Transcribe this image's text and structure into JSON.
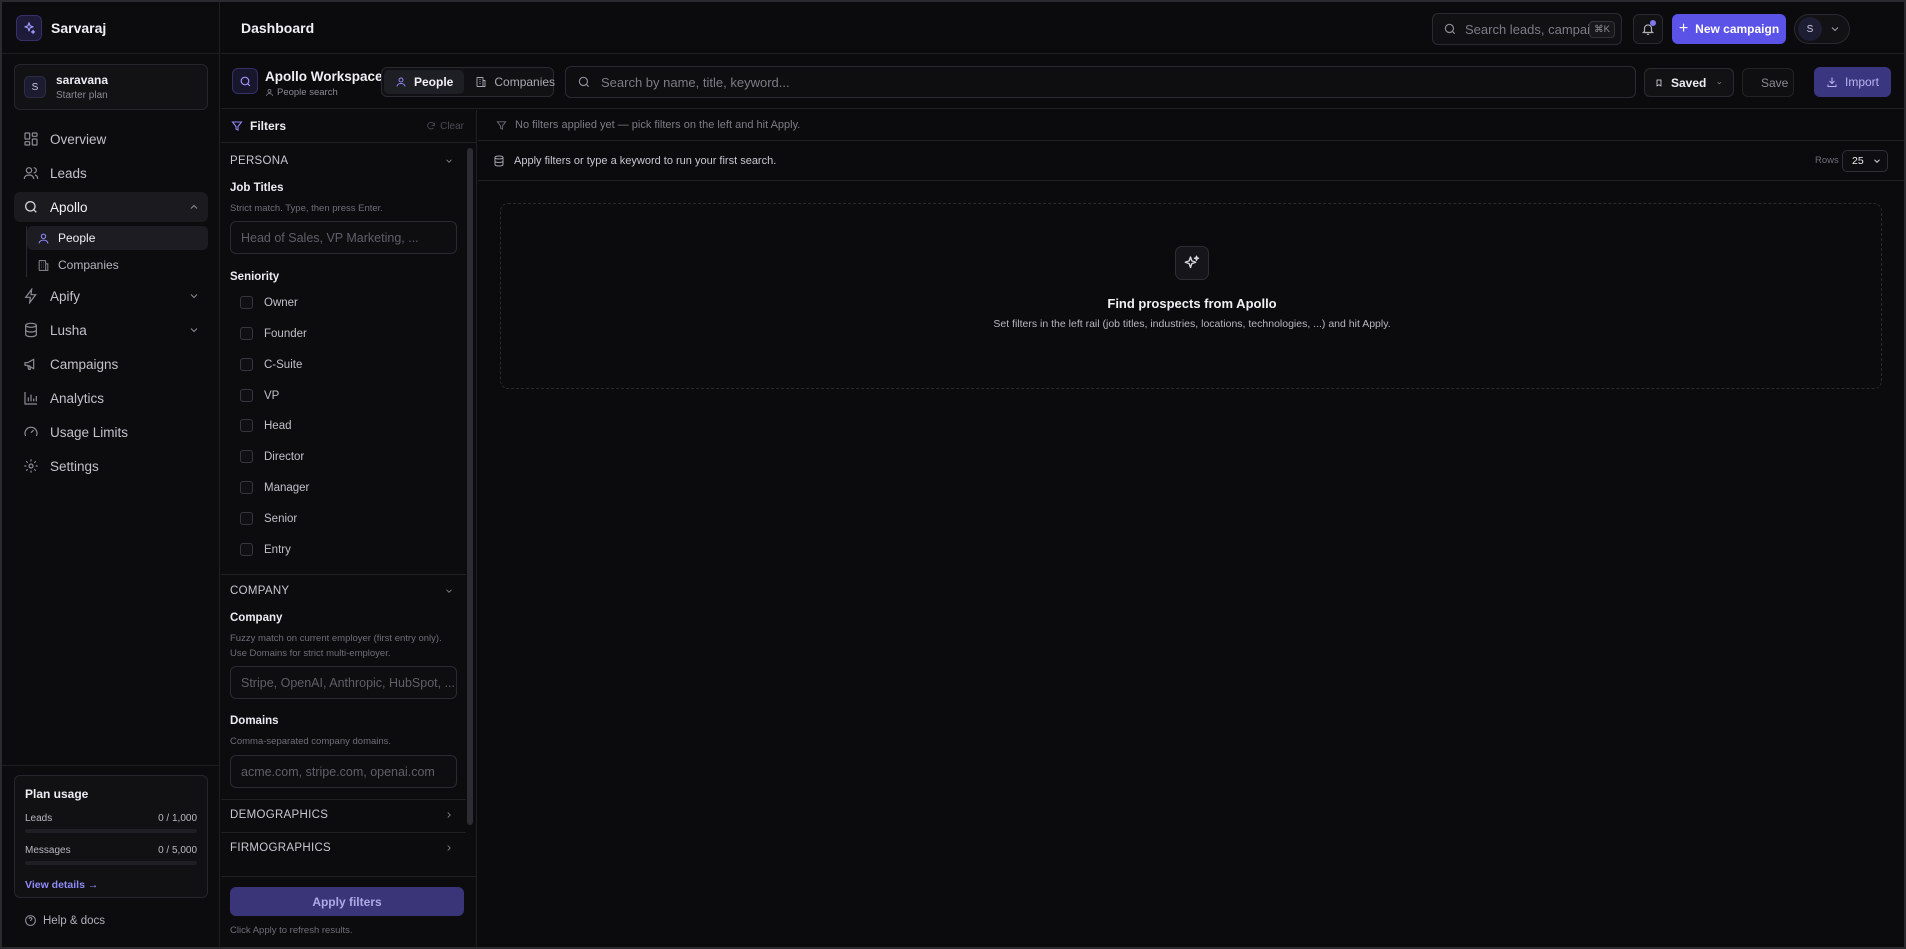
{
  "brand": {
    "name": "Sarvaraj"
  },
  "user": {
    "initial": "S",
    "name": "saravana",
    "plan": "Starter plan"
  },
  "nav": {
    "overview": "Overview",
    "leads": "Leads",
    "apollo": "Apollo",
    "apollo_people": "People",
    "apollo_companies": "Companies",
    "apify": "Apify",
    "lusha": "Lusha",
    "campaigns": "Campaigns",
    "analytics": "Analytics",
    "usage_limits": "Usage Limits",
    "settings": "Settings"
  },
  "plan_usage": {
    "title": "Plan usage",
    "leads_label": "Leads",
    "leads_value": "0 / 1,000",
    "leads_fraction": 0,
    "messages_label": "Messages",
    "messages_value": "0 / 5,000",
    "messages_fraction": 0,
    "link": "View details →"
  },
  "help": "Help & docs",
  "topbar": {
    "title": "Dashboard",
    "search_placeholder": "Search leads, campaigns...",
    "shortcut": "⌘K",
    "new_campaign": "New campaign",
    "account_initial": "S"
  },
  "workspace": {
    "title": "Apollo Workspace",
    "subtitle": "People search",
    "tab_people": "People",
    "tab_companies": "Companies",
    "search_placeholder": "Search by name, title, keyword...",
    "saved": "Saved",
    "save": "Save",
    "import": "Import"
  },
  "filters": {
    "title": "Filters",
    "clear": "Clear",
    "persona": "PERSONA",
    "job_titles_label": "Job Titles",
    "job_titles_hint": "Strict match. Type, then press Enter.",
    "job_titles_placeholder": "Head of Sales, VP Marketing, ...",
    "seniority_label": "Seniority",
    "seniority_options": [
      "Owner",
      "Founder",
      "C-Suite",
      "VP",
      "Head",
      "Director",
      "Manager",
      "Senior",
      "Entry"
    ],
    "company_section": "COMPANY",
    "company_label": "Company",
    "company_hint": "Fuzzy match on current employer (first entry only). Use Domains for strict multi-employer.",
    "company_placeholder": "Stripe, OpenAI, Anthropic, HubSpot, ...",
    "domains_label": "Domains",
    "domains_hint": "Comma-separated company domains.",
    "domains_placeholder": "acme.com, stripe.com, openai.com",
    "demographics": "DEMOGRAPHICS",
    "firmographics": "FIRMOGRAPHICS",
    "apply": "Apply filters",
    "apply_note": "Click Apply to refresh results."
  },
  "results": {
    "no_filters": "No filters applied yet — pick filters on the left and hit Apply.",
    "hint": "Apply filters or type a keyword to run your first search.",
    "rows_label": "Rows",
    "rows_value": "25",
    "empty_title": "Find prospects from Apollo",
    "empty_desc": "Set filters in the left rail (job titles, industries, locations, technologies, ...) and hit Apply."
  },
  "colors": {
    "accent": "#5b52e8",
    "accent_light": "#8b86f5",
    "background": "#0b0b0d"
  }
}
